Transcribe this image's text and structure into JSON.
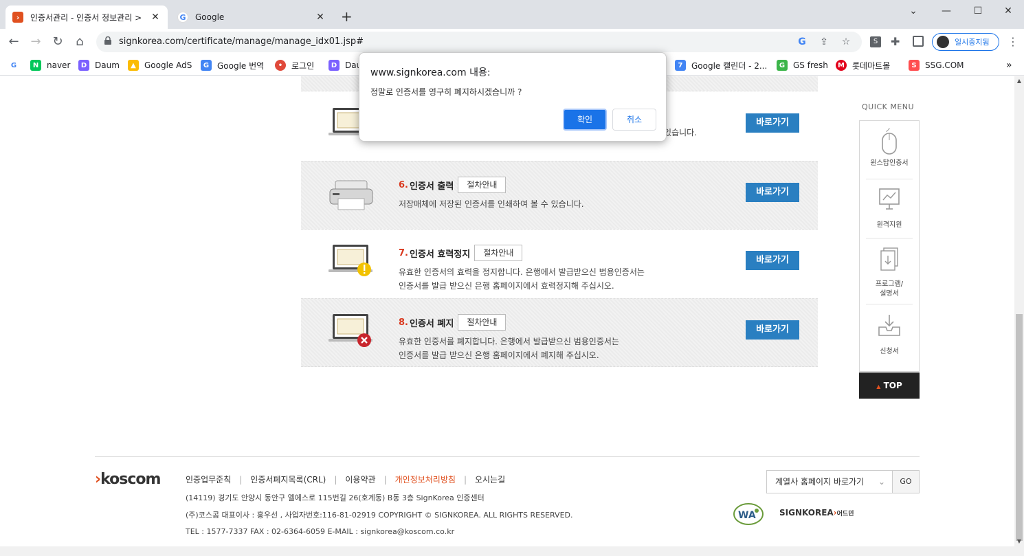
{
  "browser": {
    "tabs": [
      {
        "title": "인증서관리 - 인증서 정보관리 >",
        "active": true
      },
      {
        "title": "Google",
        "active": false
      }
    ],
    "new_tab": "+",
    "url": "signkorea.com/certificate/manage/manage_idx01.jsp#",
    "profile_label": "일시중지됨",
    "bookmarks": [
      "naver",
      "Daum",
      "Google AdS",
      "Google 번역",
      "로그인",
      "Dau",
      "Google 캘린더 - 2...",
      "GS fresh",
      "롯데마트몰",
      "SSG.COM"
    ],
    "bookmarks_more": "»"
  },
  "dialog": {
    "title": "www.signkorea.com 내용:",
    "message": "정말로 인증서를 영구히 폐지하시겠습니까 ?",
    "ok_label": "확인",
    "cancel_label": "취소"
  },
  "rows": [
    {
      "num": "",
      "title": "",
      "guide": "",
      "desc1": "있습니다.",
      "desc2": "",
      "go": "바로가기"
    },
    {
      "num": "6.",
      "title": "인증서 출력",
      "guide": "절차안내",
      "desc1": "저장매체에 저장된 인증서를 인쇄하여 볼 수 있습니다.",
      "desc2": "",
      "go": "바로가기"
    },
    {
      "num": "7.",
      "title": "인증서 효력정지",
      "guide": "절차안내",
      "desc1": "유효한 인증서의 효력을 정지합니다. 은행에서 발급받으신 범용인증서는",
      "desc2": "인증서를 발급 받으신 은행 홈페이지에서 효력정지해 주십시오.",
      "go": "바로가기"
    },
    {
      "num": "8.",
      "title": "인증서 폐지",
      "guide": "절차안내",
      "desc1": "유효한 인증서를 폐지합니다. 은행에서 발급받으신 범용인증서는",
      "desc2": "인증서를 발급 받으신 은행 홈페이지에서 폐지해 주십시오.",
      "go": "바로가기"
    }
  ],
  "quick_menu": {
    "title": "QUICK MENU",
    "items": [
      "윈스탑인증서",
      "원격지원",
      "프로그램/",
      "설명서",
      "신청서"
    ],
    "top_label": "TOP"
  },
  "footer": {
    "logo_chevron": "›",
    "logo_text": "koscom",
    "links": [
      "인증업무준칙",
      "인증서폐지목록(CRL)",
      "이용약관",
      "개인정보처리방침",
      "오시는길"
    ],
    "address": "(14119) 경기도 안양시 동안구 엘에스로 115번길 26(호계동) B동 3층 SignKorea 인증센터",
    "company": "(주)코스콤 대표이사 : 홍우선 , 사업자번호:116-81-02919  COPYRIGHT © SIGNKOREA. ALL RIGHTS RESERVED.",
    "contact": "TEL : 1577-7337    FAX : 02-6364-6059   E-MAIL : signkorea@koscom.co.kr",
    "family_select": "계열사 홈페이지 바로가기",
    "family_go": "GO",
    "wa_text": "WA",
    "signkorea_logo": "SIGNKOREA",
    "signkorea_logo_accent": "›",
    "signkorea_logo_sub": "어드민"
  }
}
